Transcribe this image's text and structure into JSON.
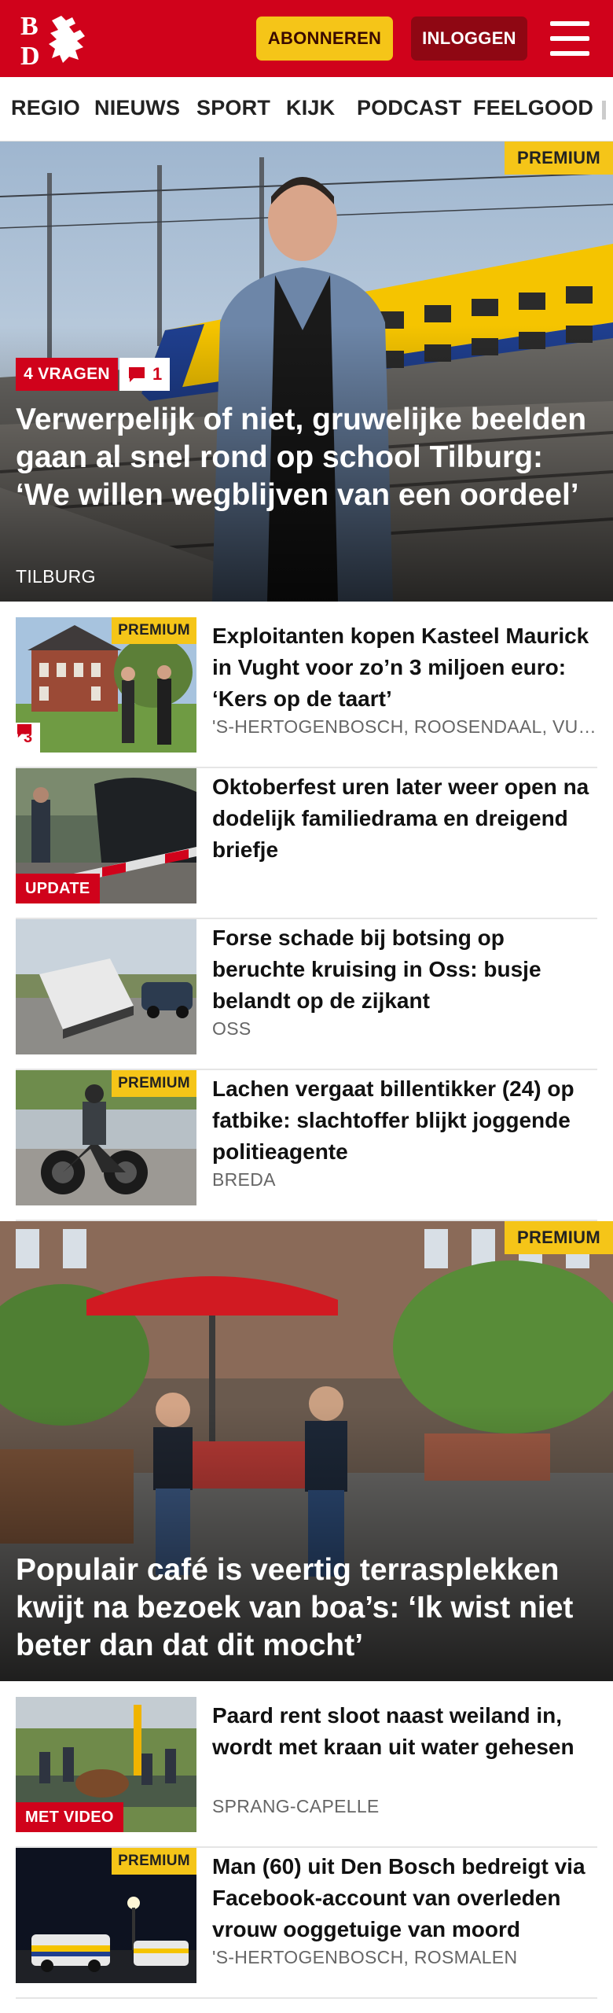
{
  "header": {
    "logo_letters": "BD",
    "subscribe_label": "ABONNEREN",
    "login_label": "INLOGGEN",
    "colors": {
      "brand_red": "#d0021b",
      "premium_yellow": "#f5c518",
      "login_dark_red": "#8f0713"
    }
  },
  "nav": {
    "items": [
      "REGIO",
      "NIEUWS",
      "SPORT",
      "KIJK",
      "PODCAST",
      "FEELGOOD"
    ]
  },
  "hero1": {
    "premium_label": "PREMIUM",
    "tag_label": "4 VRAGEN",
    "comment_count": "1",
    "title": "Verwerpelijk of niet, gruwelijke beelden gaan al snel rond op school Tilburg: ‘We willen wegblijven van een oordeel’",
    "location": "TILBURG"
  },
  "articles": [
    {
      "title": "Exploitanten kopen Kasteel Maurick in Vught voor zo’n 3 miljoen euro: ‘Kers op de taart’",
      "location": "'S-HERTOGENBOSCH, ROOSENDAAL, VUGHT",
      "premium_label": "PREMIUM",
      "comment_count": "3"
    },
    {
      "title": "Oktoberfest uren later weer open na dodelijk familiedrama en dreigend briefje",
      "badge_label": "UPDATE"
    },
    {
      "title": "Forse schade bij botsing op beruchte kruising in Oss: busje belandt op de zijkant",
      "location": "OSS"
    },
    {
      "title": "Lachen vergaat billentikker (24) op fatbike: slachtoffer blijkt joggende politieagente",
      "location": "BREDA",
      "premium_label": "PREMIUM"
    }
  ],
  "hero2": {
    "premium_label": "PREMIUM",
    "title": "Populair café is veertig terrasplekken kwijt na bezoek van boa’s: ‘Ik wist niet beter dan dat dit mocht’"
  },
  "articles2": [
    {
      "title": "Paard rent sloot naast weiland in, wordt met kraan uit water gehesen",
      "location": "SPRANG-CAPELLE",
      "badge_label": "MET VIDEO"
    },
    {
      "title": "Man (60) uit Den Bosch bedreigt via Facebook-account van overleden vrouw ooggetuige van moord",
      "location": "'S-HERTOGENBOSCH, ROSMALEN",
      "premium_label": "PREMIUM"
    }
  ]
}
